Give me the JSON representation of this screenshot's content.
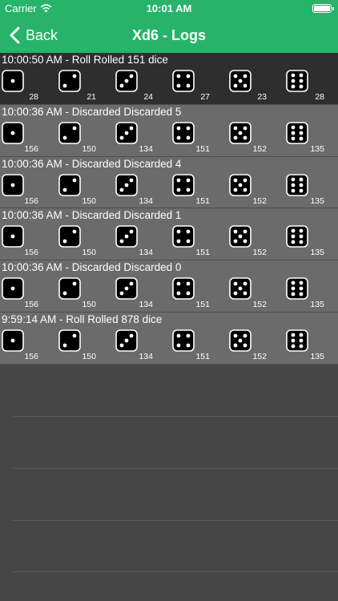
{
  "status_bar": {
    "carrier": "Carrier",
    "time": "10:01 AM"
  },
  "nav": {
    "back_label": "Back",
    "title": "Xd6 - Logs"
  },
  "logs": [
    {
      "header": "10:00:50 AM - Roll  Rolled 151 dice",
      "counts": [
        "28",
        "21",
        "24",
        "27",
        "23",
        "28"
      ]
    },
    {
      "header": "10:00:36 AM - Discarded  Discarded 5",
      "counts": [
        "156",
        "150",
        "134",
        "151",
        "152",
        "135"
      ]
    },
    {
      "header": "10:00:36 AM - Discarded  Discarded 4",
      "counts": [
        "156",
        "150",
        "134",
        "151",
        "152",
        "135"
      ]
    },
    {
      "header": "10:00:36 AM - Discarded  Discarded 1",
      "counts": [
        "156",
        "150",
        "134",
        "151",
        "152",
        "135"
      ]
    },
    {
      "header": "10:00:36 AM - Discarded  Discarded 0",
      "counts": [
        "156",
        "150",
        "134",
        "151",
        "152",
        "135"
      ]
    },
    {
      "header": "9:59:14 AM - Roll  Rolled 878 dice",
      "counts": [
        "156",
        "150",
        "134",
        "151",
        "152",
        "135"
      ]
    }
  ],
  "icons": {
    "wifi": "wifi-icon",
    "battery": "battery-icon",
    "back": "chevron-left-icon",
    "die": "die-face-icon"
  },
  "colors": {
    "accent": "#27b36a",
    "latest_row": "#2e2e2e",
    "row": "#6b6b6b",
    "background": "#464646"
  }
}
